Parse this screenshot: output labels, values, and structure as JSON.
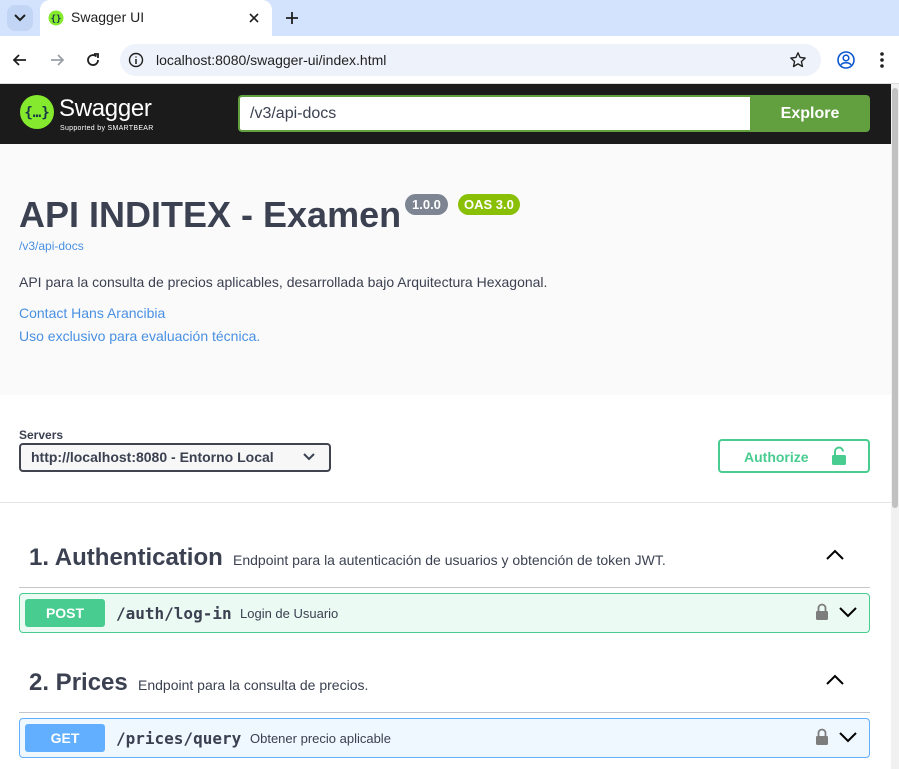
{
  "browser": {
    "tab_title": "Swagger UI",
    "url": "localhost:8080/swagger-ui/index.html"
  },
  "topbar": {
    "logo_text": "Swagger",
    "logo_sub": "Supported by SMARTBEAR",
    "spec_url": "/v3/api-docs",
    "explore_label": "Explore"
  },
  "info": {
    "title": "API INDITEX - Examen",
    "version": "1.0.0",
    "oas": "OAS 3.0",
    "spec_link": "/v3/api-docs",
    "description": "API para la consulta de precios aplicables, desarrollada bajo Arquitectura Hexagonal.",
    "contact": "Contact Hans Arancibia",
    "license": "Uso exclusivo para evaluación técnica."
  },
  "servers": {
    "label": "Servers",
    "selected": "http://localhost:8080 - Entorno Local",
    "authorize_label": "Authorize"
  },
  "tags": [
    {
      "name": "1. Authentication",
      "description": "Endpoint para la autenticación de usuarios y obtención de token JWT.",
      "operation": {
        "method": "POST",
        "path": "/auth/log-in",
        "summary": "Login de Usuario"
      }
    },
    {
      "name": "2. Prices",
      "description": "Endpoint para la consulta de precios.",
      "operation": {
        "method": "GET",
        "path": "/prices/query",
        "summary": "Obtener precio aplicable"
      }
    }
  ],
  "colors": {
    "post": "#49cc90",
    "get": "#61affe",
    "explore": "#62a03f",
    "oas_badge": "#89bf04",
    "link": "#4990e2"
  }
}
